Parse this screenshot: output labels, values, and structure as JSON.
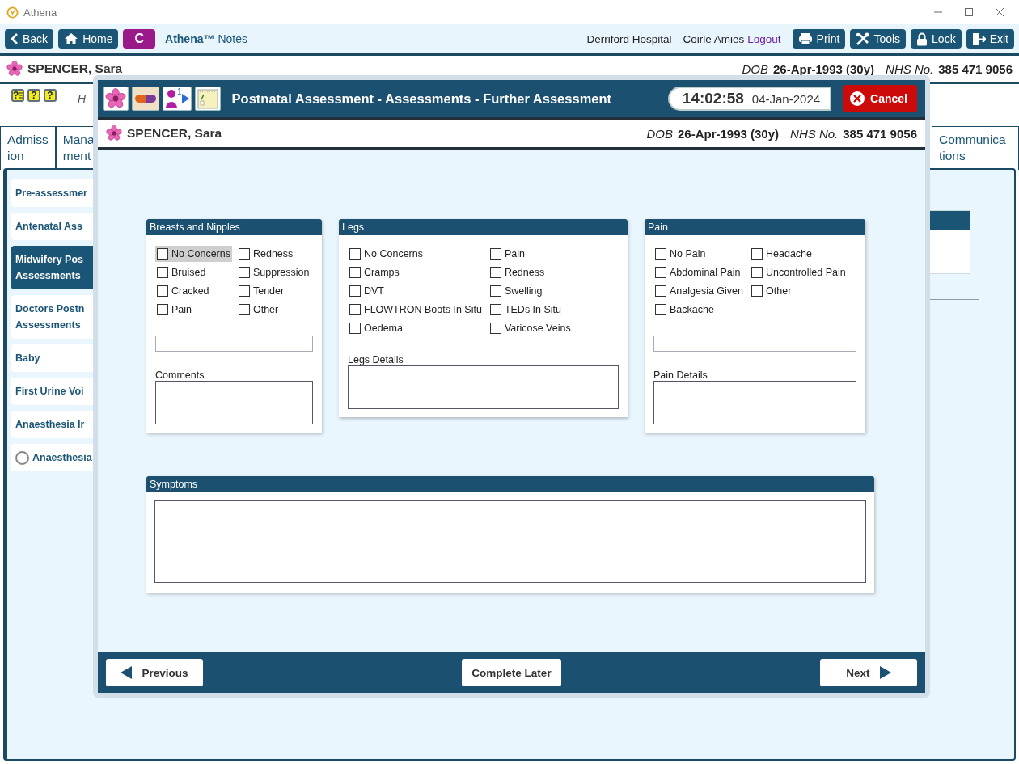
{
  "window": {
    "title": "Athena"
  },
  "toolbar": {
    "nav_buttons": [
      {
        "kind": "back",
        "label": "Back"
      },
      {
        "kind": "home",
        "label": "Home"
      },
      {
        "kind": "letter",
        "label": "C"
      }
    ],
    "app_name": "**Athena™** Notes",
    "hospital": "Derriford Hospital",
    "user": "Coirle Amies",
    "logout": "Logout",
    "actions": [
      {
        "kind": "print",
        "label": "Print"
      },
      {
        "kind": "tools",
        "label": "Tools"
      },
      {
        "kind": "lock",
        "label": "Lock"
      },
      {
        "kind": "exit",
        "label": "Exit"
      }
    ]
  },
  "patient": {
    "name": "SPENCER, Sara",
    "dob_label": "DOB",
    "dob": "26-Apr-1993 (30y)",
    "nhs_label": "NHS No.",
    "nhs": "385 471 9056"
  },
  "flag_icons": [
    {
      "kind": "list",
      "glyph": "?"
    },
    {
      "kind": "plain",
      "glyph": "?"
    },
    {
      "kind": "plain",
      "glyph": "?"
    }
  ],
  "header_text": "H",
  "tabs_left": [
    {
      "lines": [
        "Admiss",
        "ion"
      ]
    },
    {
      "lines": [
        "Mana",
        "ment"
      ]
    }
  ],
  "tabs_right": [
    {
      "lines": [
        "Communica",
        "tions"
      ]
    }
  ],
  "sidebar": {
    "items": [
      {
        "kind": "plain",
        "lines": [
          "Pre-assessmer"
        ],
        "selected": false
      },
      {
        "kind": "plain",
        "lines": [
          "Antenatal Ass"
        ],
        "selected": false
      },
      {
        "kind": "plain",
        "lines": [
          "Midwifery Pos",
          "Assessments"
        ],
        "selected": true
      },
      {
        "kind": "plain",
        "lines": [
          "Doctors Postn",
          "Assessments"
        ],
        "selected": false
      },
      {
        "kind": "plain",
        "lines": [
          "Baby"
        ],
        "selected": false
      },
      {
        "kind": "plain",
        "lines": [
          "First Urine Voi"
        ],
        "selected": false
      },
      {
        "kind": "plain",
        "lines": [
          "Anaesthesia Ir"
        ],
        "selected": false
      },
      {
        "kind": "radio",
        "lines": [
          "Anaesthesia"
        ],
        "selected": false
      }
    ]
  },
  "dialog": {
    "tiles": [
      {
        "kind": "flower"
      },
      {
        "kind": "pill"
      },
      {
        "kind": "person",
        "badge": "1"
      },
      {
        "kind": "note"
      }
    ],
    "title": "Postnatal Assessment - Assessments - Further Assessment",
    "time": "14:02:58",
    "date": "04-Jan-2024",
    "cancel": "Cancel",
    "patient": {
      "name": "SPENCER, Sara",
      "dob_label": "DOB",
      "dob": "26-Apr-1993 (30y)",
      "nhs_label": "NHS No.",
      "nhs": "385 471 9056"
    },
    "panels": [
      {
        "title": "Breasts and Nipples",
        "options": [
          {
            "label": "No Concerns",
            "checked": false,
            "focused": true
          },
          {
            "label": "Redness",
            "checked": false,
            "focused": false
          },
          {
            "label": "Bruised",
            "checked": false,
            "focused": false
          },
          {
            "label": "Suppression",
            "checked": false,
            "focused": false
          },
          {
            "label": "Cracked",
            "checked": false,
            "focused": false
          },
          {
            "label": "Tender",
            "checked": false,
            "focused": false
          },
          {
            "label": "Pain",
            "checked": false,
            "focused": false
          },
          {
            "label": "Other",
            "checked": false,
            "focused": false
          }
        ],
        "fields": [
          {
            "kind": "input"
          },
          {
            "kind": "label",
            "text": "Comments"
          },
          {
            "kind": "textarea"
          }
        ]
      },
      {
        "title": "Legs",
        "options": [
          {
            "label": "No Concerns",
            "checked": false,
            "focused": false
          },
          {
            "label": "Pain",
            "checked": false,
            "focused": false
          },
          {
            "label": "Cramps",
            "checked": false,
            "focused": false
          },
          {
            "label": "Redness",
            "checked": false,
            "focused": false
          },
          {
            "label": "DVT",
            "checked": false,
            "focused": false
          },
          {
            "label": "Swelling",
            "checked": false,
            "focused": false
          },
          {
            "label": "FLOWTRON Boots In Situ",
            "checked": false,
            "focused": false
          },
          {
            "label": "TEDs In Situ",
            "checked": false,
            "focused": false
          },
          {
            "label": "Oedema",
            "checked": false,
            "focused": false
          },
          {
            "label": "Varicose Veins",
            "checked": false,
            "focused": false
          }
        ],
        "fields": [
          {
            "kind": "label",
            "text": "Legs Details"
          },
          {
            "kind": "textarea"
          }
        ]
      },
      {
        "title": "Pain",
        "options": [
          {
            "label": "No Pain",
            "checked": false,
            "focused": false
          },
          {
            "label": "Headache",
            "checked": false,
            "focused": false
          },
          {
            "label": "Abdominal Pain",
            "checked": false,
            "focused": false
          },
          {
            "label": "Uncontrolled Pain",
            "checked": false,
            "focused": false
          },
          {
            "label": "Analgesia Given",
            "checked": false,
            "focused": false
          },
          {
            "label": "Other",
            "checked": false,
            "focused": false
          },
          {
            "label": "Backache",
            "checked": false,
            "focused": false
          }
        ],
        "fields": [
          {
            "kind": "input"
          },
          {
            "kind": "label",
            "text": "Pain Details"
          },
          {
            "kind": "textarea"
          }
        ]
      }
    ],
    "symptoms": {
      "title": "Symptoms"
    },
    "footer": {
      "previous": "Previous",
      "complete_later": "Complete Later",
      "next": "Next"
    }
  }
}
